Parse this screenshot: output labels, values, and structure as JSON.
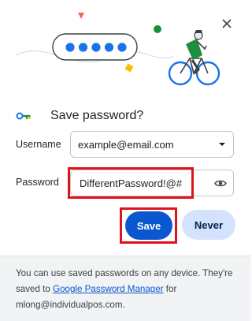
{
  "dialog": {
    "title": "Save password?",
    "icons": {
      "key": "key-icon",
      "close": "close-icon",
      "dropdown": "dropdown-arrow-icon",
      "eye": "eye-icon"
    },
    "colors": {
      "primary": "#0b57d0",
      "secondary_button_bg": "#d3e3fd",
      "highlight": "#e0121b",
      "footer_bg": "#f1f3f4"
    }
  },
  "form": {
    "username_label": "Username",
    "username_value": "example@email.com",
    "password_label": "Password",
    "password_value": "DifferentPassword!@#"
  },
  "buttons": {
    "save": "Save",
    "never": "Never"
  },
  "footer": {
    "text_before_link": "You can use saved passwords on any device. They're saved to ",
    "link_text": "Google Password Manager",
    "text_after_link": " for mlong@individualpos.com."
  }
}
